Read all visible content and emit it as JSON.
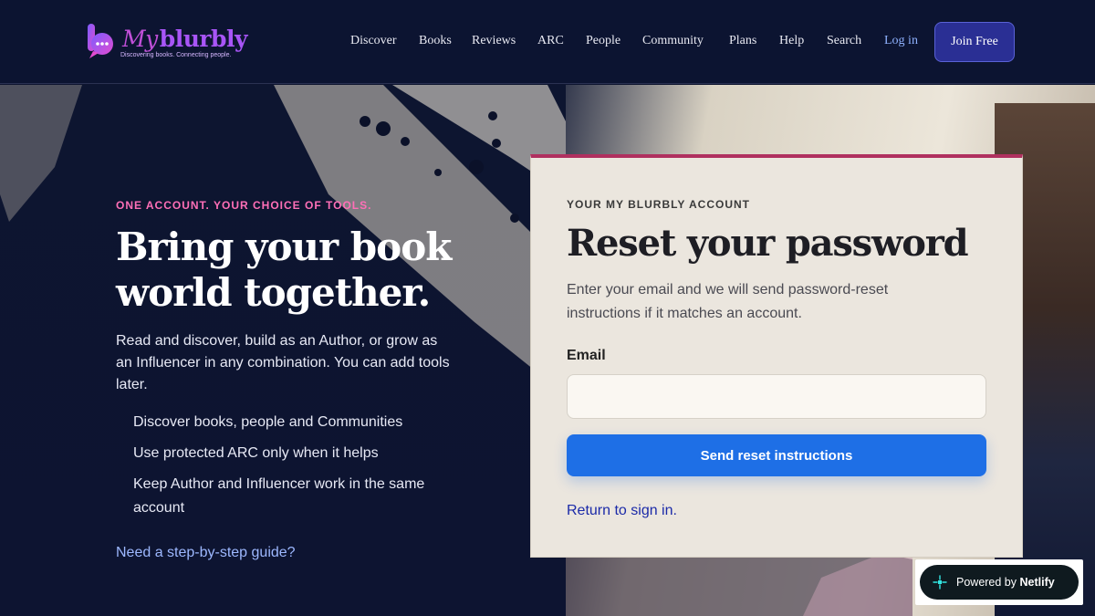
{
  "brand": {
    "name_prefix": "My",
    "name": "blurbly",
    "tagline": "Discovering books. Connecting people."
  },
  "nav": {
    "items": [
      "Discover",
      "Books",
      "Reviews",
      "ARC",
      "People",
      "Community",
      "Plans",
      "Help",
      "Search"
    ],
    "login": "Log in",
    "join": "Join Free"
  },
  "hero": {
    "eyebrow": "ONE ACCOUNT. YOUR CHOICE OF TOOLS.",
    "headline": "Bring your book world together.",
    "intro": "Read and discover, build as an Author, or grow as an Influencer in any combination. You can add tools later.",
    "bullets": [
      "Discover books, people and Communities",
      "Use protected ARC only when it helps",
      "Keep Author and Influencer work in the same account"
    ],
    "guide_link": "Need a step-by-step guide?"
  },
  "card": {
    "eyebrow": "YOUR MY BLURBLY ACCOUNT",
    "title": "Reset your password",
    "description": "Enter your email and we will send password-reset instructions if it matches an account.",
    "email_label": "Email",
    "email_value": "",
    "email_placeholder": "",
    "submit": "Send reset instructions",
    "return_link": "Return to sign in."
  },
  "netlify": {
    "prefix": "Powered by",
    "brand": "Netlify"
  },
  "colors": {
    "header_bg": "#0c1431",
    "accent_pink": "#ff6fb7",
    "card_border_top": "#b0305f",
    "primary_button": "#1e6fe6",
    "join_button": "#2a2f94"
  }
}
